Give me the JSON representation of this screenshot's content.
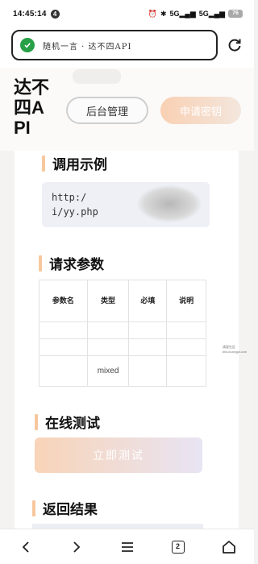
{
  "status_bar": {
    "time": "14:45:14",
    "notification_count": "4",
    "network_a": "5G",
    "network_b": "5G",
    "battery": "76"
  },
  "browser": {
    "url_title": "随机一言 · 达不四API",
    "tab_count": "2"
  },
  "header": {
    "logo": "达不四API",
    "admin_button": "后台管理",
    "apply_button": "申请密钥"
  },
  "sections": {
    "usage_example": "调用示例",
    "request_params": "请求参数",
    "online_test": "在线测试",
    "return_result": "返回结果"
  },
  "code_example": {
    "line1_prefix": "http:/",
    "line1_suffix": "p",
    "line2": "i/yy.php"
  },
  "param_table": {
    "headers": [
      "参数名",
      "类型",
      "必填",
      "说明"
    ],
    "rows": [
      [
        "",
        "",
        "",
        ""
      ],
      [
        "",
        "",
        "",
        ""
      ],
      [
        "",
        "mixed",
        "",
        ""
      ]
    ]
  },
  "test_button": "立即测试",
  "watermark": {
    "line1": "清夏社区",
    "line2": "bbs.liuxingw.com"
  },
  "colors": {
    "accent": "#f7c89e",
    "shield_green": "#27a048",
    "code_bg": "#eef0f6"
  }
}
